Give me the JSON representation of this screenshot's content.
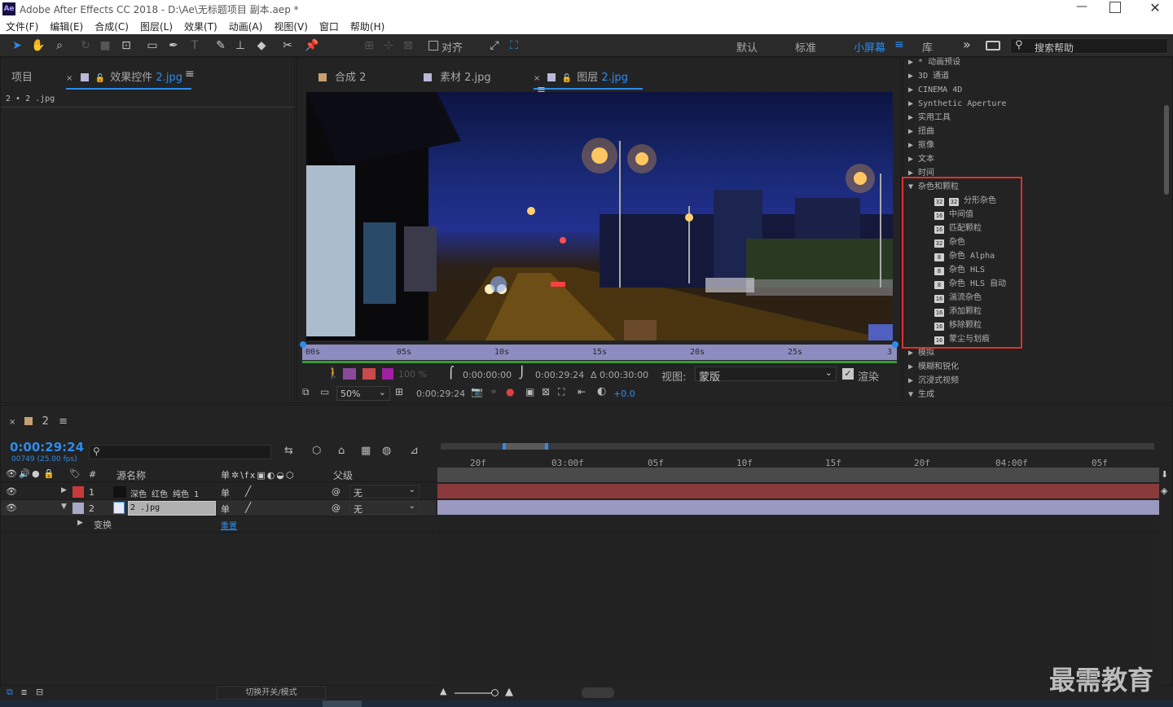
{
  "titlebar": {
    "title": "Adobe After Effects CC 2018 - D:\\Ae\\无标题项目 副本.aep *",
    "logo": "Ae"
  },
  "menu": [
    "文件(F)",
    "编辑(E)",
    "合成(C)",
    "图层(L)",
    "效果(T)",
    "动画(A)",
    "视图(V)",
    "窗口",
    "帮助(H)"
  ],
  "toolbar": {
    "snap_label": "对齐",
    "workspaces": [
      "默认",
      "标准",
      "小屏幕"
    ],
    "library": "库",
    "search_placeholder": "搜索帮助"
  },
  "left_panel": {
    "tab_project": "项目",
    "tab_effect_controls": "效果控件",
    "tab_effect_target": "2.jpg",
    "breadcrumb": "2 • 2 .jpg"
  },
  "viewer": {
    "tabs": [
      {
        "label": "合成",
        "target": "2"
      },
      {
        "label": "素材",
        "target": "2.jpg"
      },
      {
        "label": "图层",
        "target": "2.jpg"
      }
    ],
    "ruler_ticks": [
      "00s",
      "05s",
      "10s",
      "15s",
      "20s",
      "25s",
      "3"
    ],
    "percent": "100 %",
    "time_in": "0:00:00:00",
    "time_out": "0:00:29:24",
    "duration": "Δ 0:00:30:00",
    "view_label": "视图:",
    "view_value": "蒙版",
    "render_label": "渲染",
    "zoom": "50%",
    "current_time": "0:00:29:24",
    "exposure": "+0.0"
  },
  "effects": {
    "top_items": [
      "* 动画预设",
      "3D 通道",
      "CINEMA 4D",
      "Synthetic Aperture",
      "实用工具",
      "扭曲",
      "抠像",
      "文本",
      "时间"
    ],
    "open_category": "杂色和颗粒",
    "open_items": [
      {
        "bit": "32",
        "label": "分形杂色"
      },
      {
        "bit": "16",
        "label": "中间值"
      },
      {
        "bit": "16",
        "label": "匹配颗粒"
      },
      {
        "bit": "32",
        "label": "杂色"
      },
      {
        "bit": "8",
        "label": "杂色 Alpha"
      },
      {
        "bit": "8",
        "label": "杂色 HLS"
      },
      {
        "bit": "8",
        "label": "杂色 HLS 自动"
      },
      {
        "bit": "16",
        "label": "湍流杂色"
      },
      {
        "bit": "16",
        "label": "添加颗粒"
      },
      {
        "bit": "16",
        "label": "移除颗粒"
      },
      {
        "bit": "16",
        "label": "蒙尘与划痕"
      }
    ],
    "bottom_items": [
      "模拟",
      "模糊和锐化",
      "沉浸式视频",
      "生成"
    ],
    "highlight_color": "#e03030"
  },
  "timeline": {
    "comp_name": "2",
    "timecode": "0:00:29:24",
    "frame_info": "00749 (25.00 fps)",
    "search_placeholder": "",
    "col_source": "源名称",
    "col_parent": "父级",
    "layers": [
      {
        "num": "1",
        "name": "深色 红色 纯色 1",
        "color": "#c83a3a",
        "parent": "无",
        "bar_color": "#8a3a3a"
      },
      {
        "num": "2",
        "name": "2 .jpg",
        "color": "#a8a8c8",
        "parent": "无",
        "bar_color": "#9a9ac0"
      }
    ],
    "transform_label": "变换",
    "reset_label": "重置",
    "ruler_ticks": [
      "20f",
      "03:00f",
      "05f",
      "10f",
      "15f",
      "20f",
      "04:00f",
      "05f"
    ],
    "footer_label": "切换开关/模式"
  },
  "watermark": "最需教育"
}
